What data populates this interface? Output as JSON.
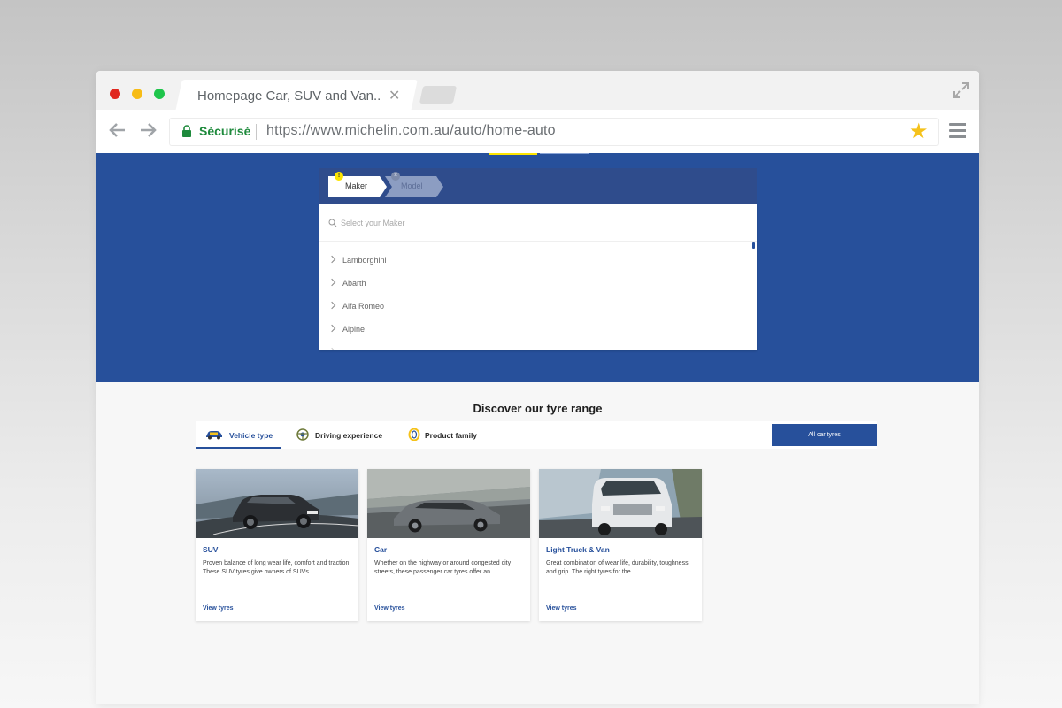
{
  "browser": {
    "tab_title": "Homepage Car, SUV and  Van..",
    "tab_close": "✕",
    "secure_label": "Sécurisé",
    "url": "https://www.michelin.com.au/auto/home-auto",
    "star": "★"
  },
  "selector": {
    "steps": [
      {
        "label": "Maker",
        "badge": "!"
      },
      {
        "label": "Model",
        "badge": "×"
      }
    ],
    "search_placeholder": "Select your Maker",
    "makers": [
      "Lamborghini",
      "Abarth",
      "Alfa Romeo",
      "Alpine"
    ]
  },
  "discover": {
    "title": "Discover our tyre range",
    "tabs": [
      {
        "label": "Vehicle type",
        "icon": "car-icon"
      },
      {
        "label": "Driving experience",
        "icon": "steering-wheel-icon"
      },
      {
        "label": "Product family",
        "icon": "tyre-icon"
      }
    ],
    "all_tyres_label": "All car tyres",
    "cards": [
      {
        "title": "SUV",
        "description": "Proven balance of long wear life, comfort and traction. These SUV tyres give owners of SUVs...",
        "link": "View tyres"
      },
      {
        "title": "Car",
        "description": "Whether on the highway or around congested city streets, these passenger car tyres offer an...",
        "link": "View tyres"
      },
      {
        "title": "Light Truck & Van",
        "description": "Great combination of wear life, durability, toughness and grip. The right tyres for the...",
        "link": "View tyres"
      }
    ]
  },
  "colors": {
    "brand_blue": "#27509b",
    "accent_yellow": "#fce500",
    "secure_green": "#1e8a3c",
    "star_yellow": "#f5c21b"
  }
}
